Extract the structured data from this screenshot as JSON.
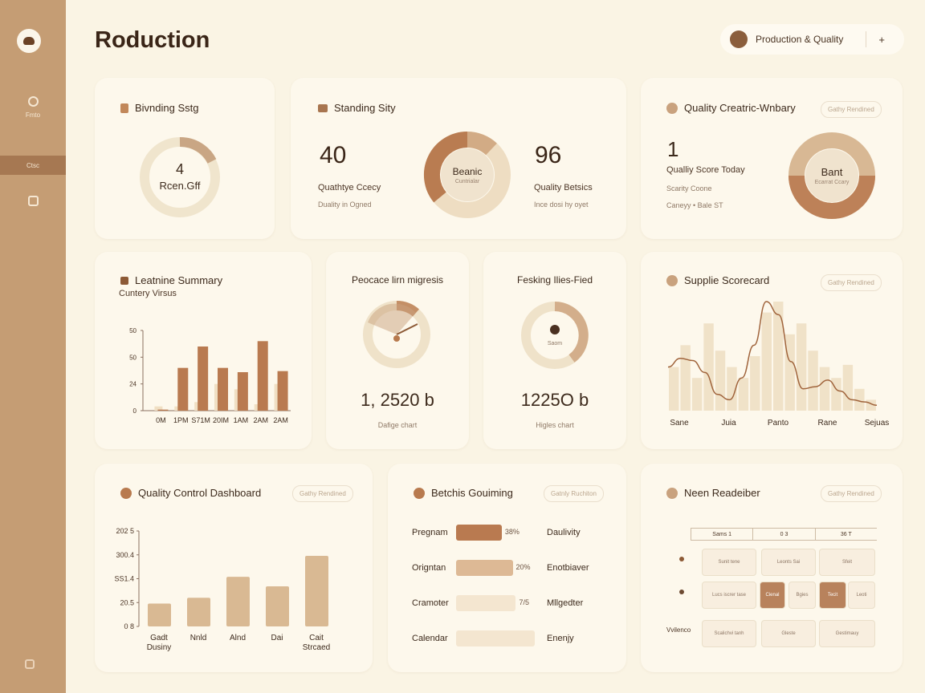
{
  "app_title": "Roduction",
  "top_pill": {
    "label": "Production & Quality",
    "close": "+"
  },
  "sidebar": {
    "items": [
      {
        "label": "Fmto"
      },
      {
        "label": "Ctsc"
      }
    ]
  },
  "cards": {
    "branding": {
      "title": "Bivnding Sstg",
      "value": "4",
      "sub": "Rcen.Gff"
    },
    "standing": {
      "title": "Standing Sity",
      "left_value": "40",
      "left_label": "Quathtye Ccecy",
      "left_sub": "Duality in Ogned",
      "donut_label": "Beanic",
      "donut_sub": "Cuntrialar",
      "right_value": "96",
      "right_label": "Quality Betsics",
      "right_sub": "Ince dosi hy oyet"
    },
    "quality_overview": {
      "title": "Quality Creatric-Wnbary",
      "badge": "Gathy Rendined",
      "value": "1",
      "label": "Qualliy Score Today",
      "sub1": "Scarity Coone",
      "sub2": "Caneyy • Bale ST",
      "donut_label": "Bant",
      "donut_sub": "Ecarrat Ccary"
    },
    "feature_summary": {
      "title": "Leatnine Summary",
      "sub": "Cuntery Virsus"
    },
    "process": {
      "title": "Peocace lirn migresis",
      "value": "1, 2520 b",
      "sub": "Dafige chart"
    },
    "resking": {
      "title": "Fesking Ilies-Fied",
      "donut_label": "Saom",
      "value": "1225O b",
      "sub": "Higles chart"
    },
    "supplie": {
      "title": "Supplie Scorecard",
      "badge": "Gathy Rendined"
    },
    "qc_dashboard": {
      "title": "Quality Control Dashboard",
      "badge": "Gathy Rendined"
    },
    "batchs": {
      "title": "Betchis Gouiming",
      "badge": "Gatnly Ruchiton"
    },
    "neen": {
      "title": "Neen Readeiber",
      "badge": "Gathy Rendined"
    }
  },
  "chart_data": [
    {
      "type": "bar",
      "categories": [
        "0M",
        "1PM",
        "S71M",
        "20IM",
        "1AM",
        "2AM",
        "2AM"
      ],
      "series": [
        {
          "values": [
            1,
            40,
            60,
            40,
            36,
            65,
            37
          ]
        },
        {
          "values": [
            4,
            4,
            8,
            25,
            20,
            6,
            25
          ]
        }
      ],
      "ytick_labels": [
        "0",
        "24",
        "50",
        "50"
      ],
      "ylim": [
        0,
        75
      ]
    },
    {
      "type": "bar",
      "categories": [
        "Gadt Dusiny",
        "Nnld",
        "Alnd",
        "Dai",
        "Cait Strcaed"
      ],
      "values": [
        6,
        7.5,
        13,
        10.5,
        18.5
      ],
      "ytick_labels": [
        "0 8",
        "20.5",
        "SS1.4",
        "300.4",
        "202 5"
      ],
      "ylim": [
        0,
        25
      ]
    },
    {
      "type": "area",
      "categories": [
        "Sane",
        "Juia",
        "Panto",
        "Rane",
        "Sejuas"
      ],
      "bars": [
        40,
        60,
        30,
        80,
        55,
        40,
        30,
        50,
        90,
        100,
        70,
        80,
        55,
        40,
        30,
        42,
        20,
        10
      ],
      "line": [
        40,
        48,
        46,
        35,
        15,
        10,
        30,
        60,
        100,
        88,
        45,
        20,
        22,
        28,
        18,
        10,
        8,
        5
      ]
    },
    {
      "type": "bar",
      "categories": [
        "Pregnam",
        "Origntan",
        "Cramoter",
        "Calendar"
      ],
      "values": [
        58,
        72,
        76,
        100
      ],
      "pct_labels": [
        "38%",
        "20%",
        "7/5",
        ""
      ],
      "right_labels": [
        "Daulivity",
        "Enotbiaver",
        "Mllgedter",
        "Enenjy"
      ]
    }
  ],
  "neen_grid": {
    "headers": [
      "Sams 1",
      "0 3",
      "36 T"
    ],
    "rows": [
      {
        "label": "",
        "cells": [
          "Sunit tene",
          "Leonts Sai",
          "Sfeit"
        ]
      },
      {
        "label": "",
        "cells": [
          "Lucs iscrer tase",
          "Cienal",
          "Bgies",
          "Tecit",
          "Leoti"
        ]
      },
      {
        "label": "Vvilenco",
        "cells": [
          "Scalichvi tanh",
          "Gleste",
          "Gestimauy"
        ]
      }
    ]
  }
}
